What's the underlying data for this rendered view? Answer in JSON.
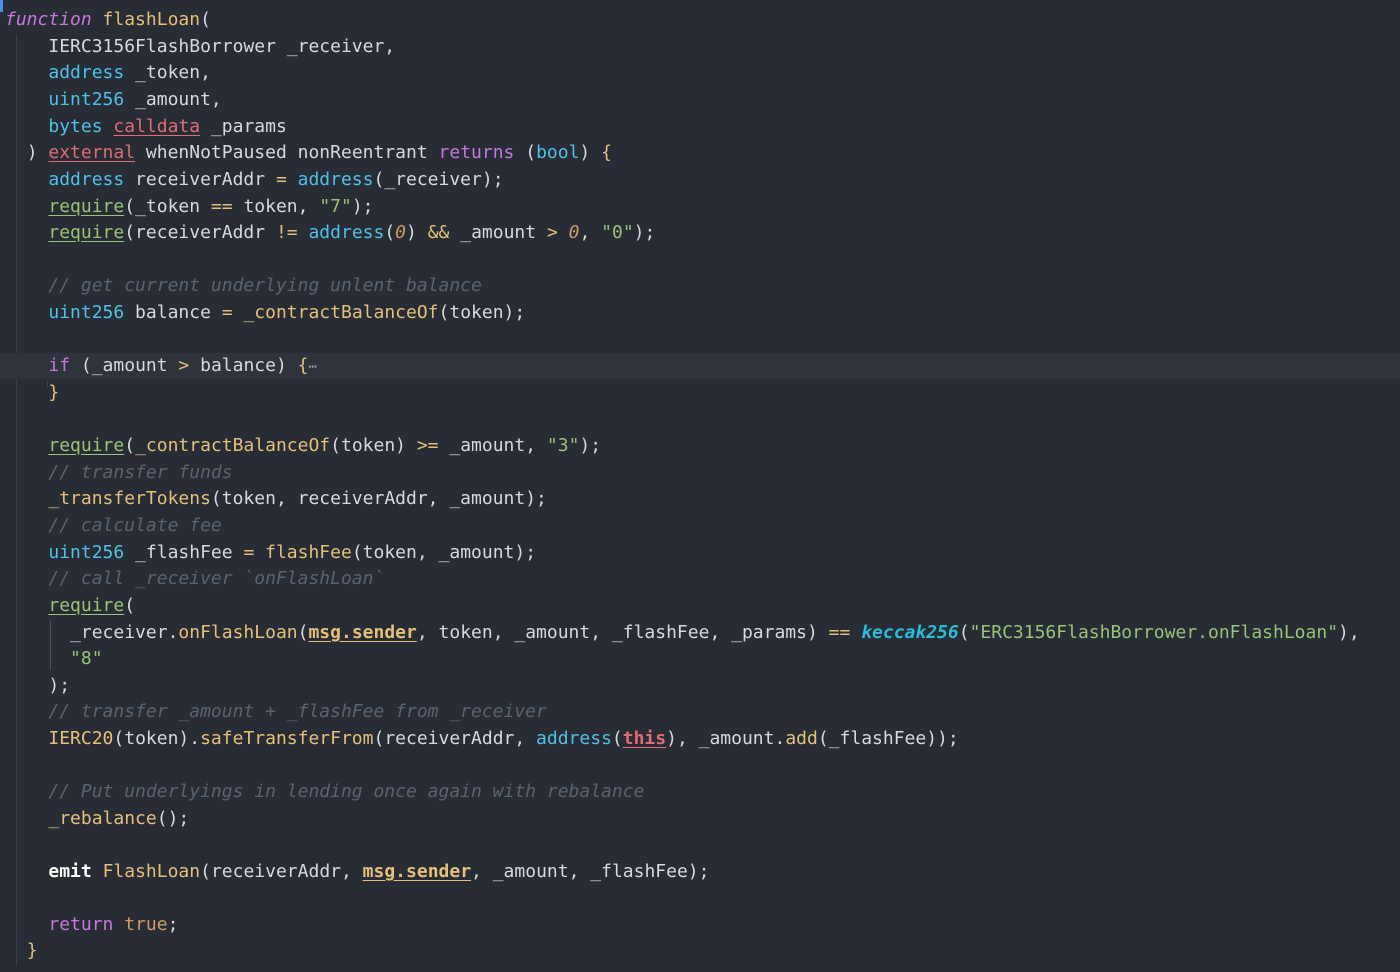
{
  "code": {
    "l1": {
      "kw": "function",
      "name": "flashLoan",
      "rest": "("
    },
    "l2": {
      "text": "IERC3156FlashBorrower _receiver,"
    },
    "l3": {
      "type": "address",
      "rest": " _token,"
    },
    "l4": {
      "type": "uint256",
      "rest": " _amount,"
    },
    "l5": {
      "type": "bytes",
      "mod": "calldata",
      "rest": " _params"
    },
    "l6": {
      "open": ") ",
      "mod": "external",
      "mid": " whenNotPaused nonReentrant ",
      "kw": "returns",
      "p1": " (",
      "type": "bool",
      "p2": ") ",
      "brace": "{"
    },
    "l7": {
      "type": "address",
      "mid": " receiverAddr ",
      "op": "=",
      "sp": " ",
      "type2": "address",
      "rest": "(_receiver);"
    },
    "l8": {
      "req": "require",
      "a": "(_token ",
      "op": "==",
      "b": " token, ",
      "str": "\"7\"",
      "c": ");"
    },
    "l9": {
      "req": "require",
      "a": "(receiverAddr ",
      "op": "!=",
      "sp": " ",
      "type": "address",
      "p": "(",
      "num": "0",
      "b": ") ",
      "op2": "&&",
      "c": " _amount ",
      "op3": ">",
      "sp2": " ",
      "num2": "0",
      "d": ", ",
      "str": "\"0\"",
      "e": ");"
    },
    "l10": {
      "comment": "// get current underlying unlent balance"
    },
    "l11": {
      "type": "uint256",
      "mid": " balance ",
      "op": "=",
      "sp": " ",
      "fn": "_contractBalanceOf",
      "rest": "(token);"
    },
    "l12": {
      "kw": "if",
      "a": " (_amount ",
      "op": ">",
      "b": " balance) ",
      "brace": "{",
      "fold": "⋯"
    },
    "l13": {
      "brace": "}"
    },
    "l14": {
      "req": "require",
      "p": "(",
      "fn": "_contractBalanceOf",
      "a": "(token) ",
      "op": ">=",
      "b": " _amount, ",
      "str": "\"3\"",
      "c": ");"
    },
    "l15": {
      "comment": "// transfer funds"
    },
    "l16": {
      "fn": "_transferTokens",
      "rest": "(token, receiverAddr, _amount);"
    },
    "l17": {
      "comment": "// calculate fee"
    },
    "l18": {
      "type": "uint256",
      "mid": " _flashFee ",
      "op": "=",
      "sp": " ",
      "fn": "flashFee",
      "rest": "(token, _amount);"
    },
    "l19": {
      "comment": "// call _receiver `onFlashLoan`"
    },
    "l20": {
      "req": "require",
      "rest": "("
    },
    "l21": {
      "a": "_receiver.",
      "fn": "onFlashLoan",
      "p": "(",
      "msg": "msg.sender",
      "b": ", token, _amount, _flashFee, _params) ",
      "op": "==",
      "sp": " ",
      "kecc": "keccak256",
      "c": "(",
      "str": "\"ERC3156FlashBorrower.onFlashLoan\"",
      "d": "),"
    },
    "l22": {
      "str": "\"8\""
    },
    "l23": {
      "text": ");"
    },
    "l24": {
      "comment": "// transfer _amount + _flashFee from _receiver"
    },
    "l25": {
      "fn": "IERC20",
      "a": "(token).",
      "fn2": "safeTransferFrom",
      "b": "(receiverAddr, ",
      "type": "address",
      "p": "(",
      "this": "this",
      "c": "), _amount.",
      "fn3": "add",
      "d": "(_flashFee));"
    },
    "l26": {
      "comment": "// Put underlyings in lending once again with rebalance"
    },
    "l27": {
      "fn": "_rebalance",
      "rest": "();"
    },
    "l28": {
      "kw": "emit",
      "sp": " ",
      "fn": "FlashLoan",
      "a": "(receiverAddr, ",
      "msg": "msg.sender",
      "b": ", _amount, _flashFee);"
    },
    "l29": {
      "kw": "return",
      "sp": " ",
      "val": "true",
      "rest": ";"
    },
    "l30": {
      "brace": "}"
    }
  },
  "colors": {
    "background": "#282c34",
    "keyword": "#c678dd",
    "type": "#4fc1e9",
    "function": "#e5c07b",
    "string": "#98c379",
    "comment": "#5c6370",
    "error_underline": "#e06c75"
  }
}
